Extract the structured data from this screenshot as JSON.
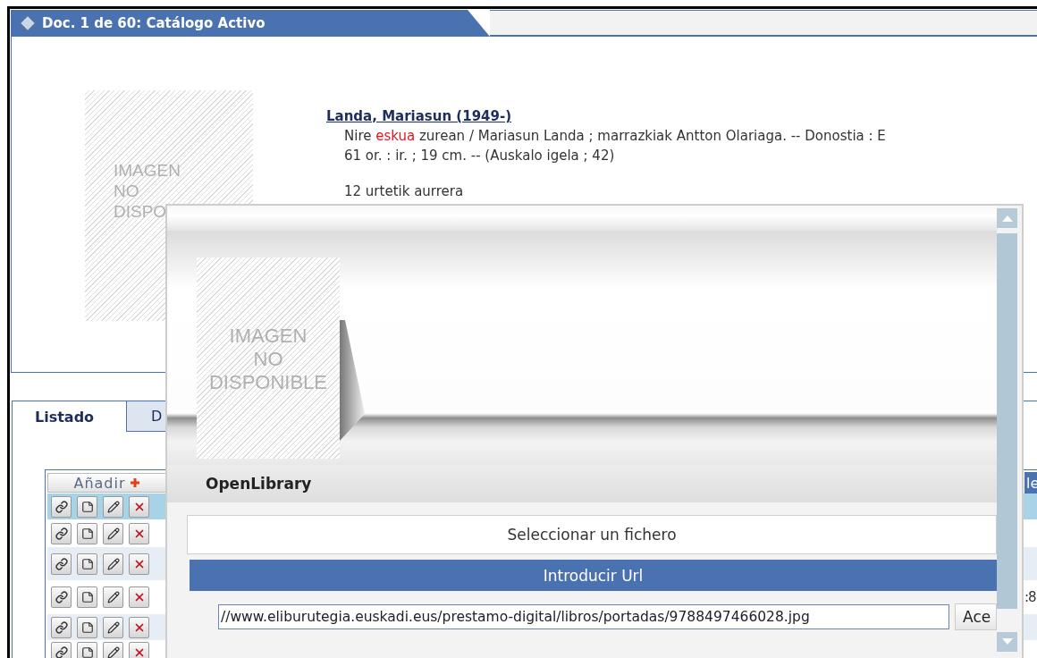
{
  "document_header": {
    "title": "Doc. 1 de 60: Catálogo Activo"
  },
  "record": {
    "placeholder_image": [
      "IMAGEN",
      "NO",
      "DISPO"
    ],
    "author": "Landa, Mariasun (1949-)",
    "description": [
      [
        {
          "text": "Nire ",
          "highlight": false
        },
        {
          "text": "eskua",
          "highlight": true
        },
        {
          "text": " zurean / Mariasun Landa ; marrazkiak Antton Olariaga. -- Donostia : E",
          "highlight": false
        }
      ],
      [
        {
          "text": "61 or. : ir. ; 19 cm. -- (Auskalo igela ; 42)",
          "highlight": false
        }
      ]
    ],
    "note": "12 urtetik aurrera"
  },
  "tabs": [
    {
      "label": "Listado",
      "selected": true
    },
    {
      "label": "D",
      "selected": false
    }
  ],
  "table": {
    "add_label": "Añadir",
    "column_3_header": "le",
    "rows": [
      {
        "selected": true
      },
      {
        "selected": false
      },
      {
        "selected": false
      },
      {
        "selected": false,
        "column_3": ":8"
      },
      {
        "selected": false
      },
      {
        "selected": false
      }
    ]
  },
  "dialog": {
    "placeholder_image": [
      "IMAGEN",
      "NO",
      "DISPONIBLE"
    ],
    "section_title": "OpenLibrary",
    "options": [
      {
        "label": "Seleccionar un fichero",
        "selected": false
      },
      {
        "label": "Introducir Url",
        "selected": true
      }
    ],
    "url_value": "//www.eliburutegia.euskadi.eus/prestamo-digital/libros/portadas/9788497466028.jpg",
    "accept_label": "Ace"
  }
}
